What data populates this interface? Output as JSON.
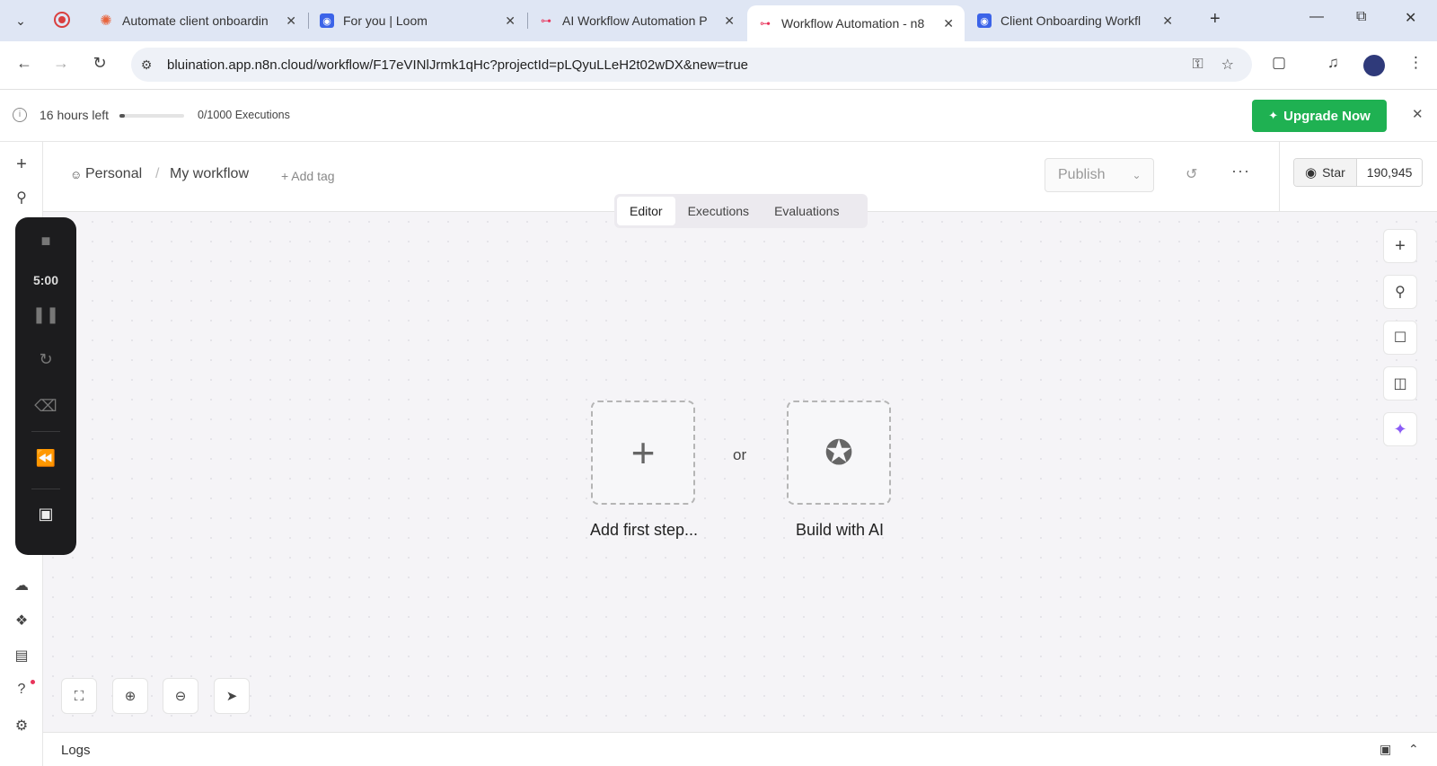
{
  "browser": {
    "tabs": [
      {
        "title": "Automate client onboardin",
        "favicon": "asterisk-icon",
        "color": "#e8633b",
        "active": false
      },
      {
        "title": "For you | Loom",
        "favicon": "loom-icon",
        "color": "#3b63e8",
        "active": false
      },
      {
        "title": "AI Workflow Automation P",
        "favicon": "n8n-icon",
        "color": "#e8335a",
        "active": false
      },
      {
        "title": "Workflow Automation - n8",
        "favicon": "n8n-icon",
        "color": "#e8335a",
        "active": true
      },
      {
        "title": "Client Onboarding Workfl",
        "favicon": "loom-icon",
        "color": "#3b63e8",
        "active": false
      }
    ],
    "url": "bluination.app.n8n.cloud/workflow/F17eVINlJrmk1qHc?projectId=pLQyuLLeH2t02wDX&new=true"
  },
  "banner": {
    "hours_left": "16 hours left",
    "progress": 0.02,
    "executions": "0/1000 Executions",
    "upgrade_label": "Upgrade Now"
  },
  "recorder": {
    "timer": "5:00"
  },
  "header": {
    "project": "Personal",
    "workflow_name": "My workflow",
    "add_tag": "+ Add tag",
    "publish_label": "Publish",
    "star_label": "Star",
    "star_count": "190,945"
  },
  "switcher": {
    "tabs": [
      "Editor",
      "Executions",
      "Evaluations"
    ],
    "active": "Editor"
  },
  "canvas": {
    "add_first_step": "Add first step...",
    "or": "or",
    "build_with_ai": "Build with AI"
  },
  "logs": {
    "label": "Logs"
  },
  "colors": {
    "accent_green": "#1fb152",
    "ai_purple": "#8b5cf6"
  }
}
